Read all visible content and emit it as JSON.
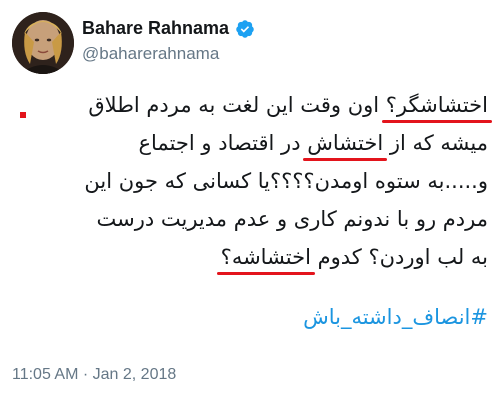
{
  "user": {
    "display_name": "Bahare Rahnama",
    "handle": "@baharerahnama"
  },
  "tweet": {
    "lines": [
      [
        "اختشاشگر؟",
        " اون وقت این لغت به مردم اطلاق"
      ],
      [
        "میشه  که از ",
        "اختشاش",
        " در اقتصاد و اجتماع"
      ],
      [
        "و.....به ستوه اومدن؟؟؟؟یا کسانی که جون این"
      ],
      [
        "مردم رو با ندونم کاری و عدم مدیریت درست"
      ],
      [
        "به لب اوردن؟ کدوم ",
        "اختشاشه؟"
      ]
    ],
    "hashtag": "#انصاف_داشته_باش",
    "timestamp": "11:05 AM · Jan 2, 2018"
  },
  "colors": {
    "underline": "#e3141c",
    "hashtag": "#1b95e0",
    "verified": "#1da1f2"
  },
  "icons": {
    "verified": "verified-badge-icon",
    "avatar": "profile-photo"
  }
}
